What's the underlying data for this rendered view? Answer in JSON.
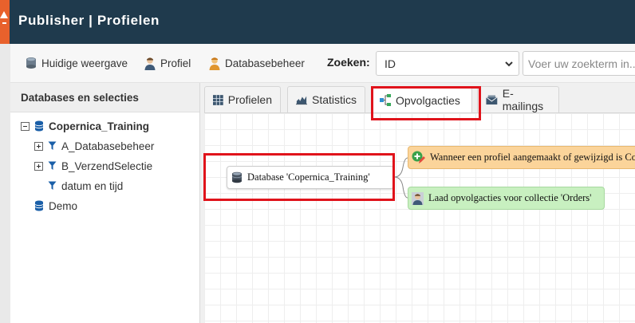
{
  "header": {
    "title": "Publisher | Profielen"
  },
  "toolbar": {
    "current_view_label": "Huidige weergave",
    "profile_label": "Profiel",
    "database_mgmt_label": "Databasebeheer",
    "search_label": "Zoeken:",
    "search_field_value": "ID",
    "search_placeholder": "Voer uw zoekterm in..."
  },
  "sidebar": {
    "title": "Databases en selecties",
    "tree": [
      {
        "label": "Copernica_Training",
        "bold": true,
        "expander": "minus",
        "icon": "database-icon"
      },
      {
        "label": "A_Databasebeheer",
        "expander": "plus",
        "icon": "filter-icon"
      },
      {
        "label": "B_VerzendSelectie",
        "expander": "plus",
        "icon": "filter-icon"
      },
      {
        "label": "datum en tijd",
        "expander": "none",
        "icon": "filter-icon"
      },
      {
        "label": "Demo",
        "expander": "none",
        "icon": "database-icon"
      }
    ]
  },
  "tabs": [
    {
      "label": "Profielen",
      "icon": "grid-icon",
      "active": false
    },
    {
      "label": "Statistics",
      "icon": "chart-icon",
      "active": false
    },
    {
      "label": "Opvolgacties",
      "icon": "flow-icon",
      "active": true
    },
    {
      "label": "E-mailings",
      "icon": "envelope-icon",
      "active": false
    }
  ],
  "workflow": {
    "database_node": "Database 'Copernica_Training'",
    "trigger_node": "Wanneer een profiel aangemaakt of gewijzigd is Cond",
    "load_node": "Laad opvolgacties voor collectie 'Orders'"
  },
  "colors": {
    "header_bg": "#1f3a4d",
    "logo_accent": "#e8612c",
    "highlight": "#e0131b",
    "icon_blue": "#1a5fa8",
    "trigger_bg": "#fbd49a",
    "load_bg": "#c8f0c0"
  }
}
